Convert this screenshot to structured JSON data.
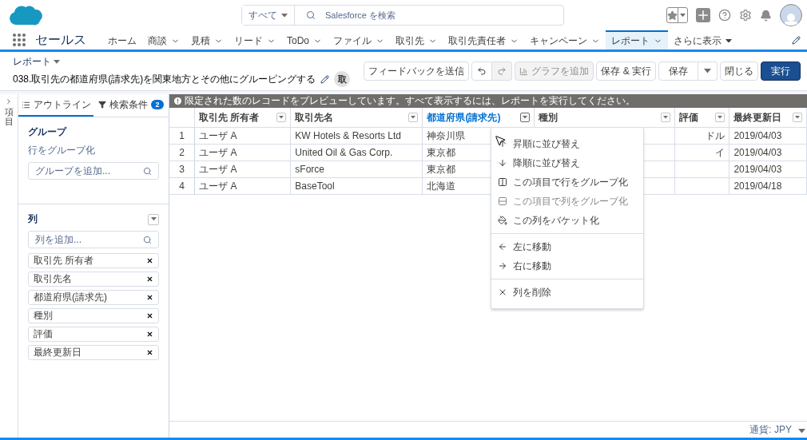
{
  "header": {
    "search": {
      "scope": "すべて",
      "placeholder": "Salesforce を検索"
    }
  },
  "nav": {
    "app_name": "セールス",
    "tabs": [
      {
        "label": "ホーム",
        "has_menu": false,
        "selected": false
      },
      {
        "label": "商談",
        "has_menu": true,
        "selected": false
      },
      {
        "label": "見積",
        "has_menu": true,
        "selected": false
      },
      {
        "label": "リード",
        "has_menu": true,
        "selected": false
      },
      {
        "label": "ToDo",
        "has_menu": true,
        "selected": false
      },
      {
        "label": "ファイル",
        "has_menu": true,
        "selected": false
      },
      {
        "label": "取引先",
        "has_menu": true,
        "selected": false
      },
      {
        "label": "取引先責任者",
        "has_menu": true,
        "selected": false
      },
      {
        "label": "キャンペーン",
        "has_menu": true,
        "selected": false
      },
      {
        "label": "レポート",
        "has_menu": true,
        "selected": true
      }
    ],
    "more": "さらに表示"
  },
  "report": {
    "breadcrumb": "レポート",
    "title": "038.取引先の都道府県(請求先)を関東地方とその他にグルーピングする",
    "badge": "取",
    "buttons": [
      {
        "kind": "text",
        "label": "フィードバックを送信",
        "disabled": false
      },
      {
        "kind": "undo",
        "disabled": false
      },
      {
        "kind": "redo",
        "disabled": true
      },
      {
        "kind": "chart",
        "label": "グラフを追加",
        "disabled": true
      },
      {
        "kind": "text",
        "label": "保存 & 実行",
        "disabled": false
      },
      {
        "kind": "split",
        "label": "保存",
        "disabled": false
      },
      {
        "kind": "text",
        "label": "閉じる",
        "disabled": false
      },
      {
        "kind": "primary",
        "label": "実行",
        "disabled": false
      }
    ]
  },
  "side_strip": {
    "label": "項目"
  },
  "panel": {
    "tabs": [
      {
        "label": "アウトライン",
        "selected": true
      },
      {
        "label": "検索条件",
        "count": "2",
        "selected": false
      }
    ],
    "group": {
      "heading": "グループ",
      "sublabel": "行をグループ化",
      "placeholder": "グループを追加..."
    },
    "columns": {
      "heading": "列",
      "placeholder": "列を追加...",
      "items": [
        "取引先 所有者",
        "取引先名",
        "都道府県(請求先)",
        "種別",
        "評価",
        "最終更新日"
      ]
    }
  },
  "preview_notice": "限定された数のレコードをプレビューしています。すべて表示するには、レポートを実行してください。",
  "table": {
    "columns": [
      {
        "label": "取引先 所有者",
        "selected": false
      },
      {
        "label": "取引先名",
        "selected": false
      },
      {
        "label": "都道府県(請求先)",
        "selected": true
      },
      {
        "label": "種別",
        "selected": false
      },
      {
        "label": "評価",
        "selected": false
      },
      {
        "label": "最終更新日",
        "selected": false
      }
    ],
    "rows": [
      {
        "number": "1",
        "cells": [
          "ユーザ A",
          "KW Hotels & Resorts Ltd",
          "神奈川県",
          null,
          "ドル",
          "2019/04/03"
        ]
      },
      {
        "number": "2",
        "cells": [
          "ユーザ A",
          "United Oil & Gas Corp.",
          "東京都",
          null,
          "イ",
          "2019/04/03"
        ]
      },
      {
        "number": "3",
        "cells": [
          "ユーザ A",
          "sForce",
          "東京都",
          null,
          null,
          "2019/04/03"
        ]
      },
      {
        "number": "4",
        "cells": [
          "ユーザ A",
          "BaseTool",
          "北海道",
          null,
          null,
          "2019/04/18"
        ]
      }
    ]
  },
  "column_menu": {
    "sections": [
      [
        {
          "kind": "sort-asc",
          "label": "昇順に並び替え",
          "disabled": false
        },
        {
          "kind": "sort-desc",
          "label": "降順に並び替え",
          "disabled": false
        },
        {
          "kind": "group-rows",
          "label": "この項目で行をグループ化",
          "disabled": false
        },
        {
          "kind": "group-columns",
          "label": "この項目で列をグループ化",
          "disabled": true
        },
        {
          "kind": "bucket",
          "label": "この列をバケット化",
          "disabled": false
        }
      ],
      [
        {
          "kind": "move-left",
          "label": "左に移動",
          "disabled": false
        },
        {
          "kind": "move-right",
          "label": "右に移動",
          "disabled": false
        }
      ],
      [
        {
          "kind": "remove",
          "label": "列を削除",
          "disabled": false
        }
      ]
    ]
  },
  "footer": {
    "currency": "通貨: JPY"
  }
}
